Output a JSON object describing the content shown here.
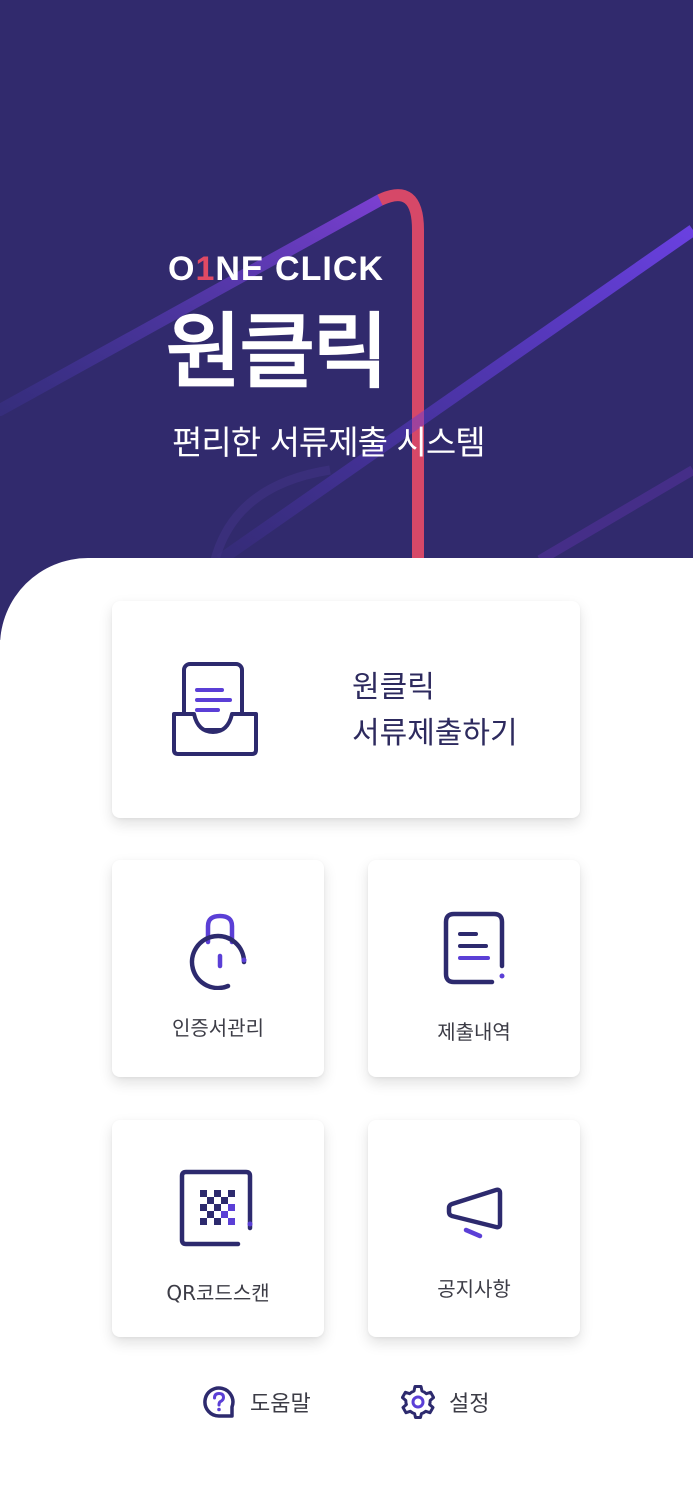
{
  "hero": {
    "brand_part1": "O",
    "brand_accent": "1",
    "brand_part2": "NE CLICK",
    "title": "원클릭",
    "subtitle": "편리한 서류제출 시스템"
  },
  "main_card": {
    "line1": "원클릭",
    "line2": "서류제출하기",
    "icon": "document-tray-icon"
  },
  "menu": [
    {
      "label": "인증서관리",
      "icon": "lock-icon"
    },
    {
      "label": "제출내역",
      "icon": "document-list-icon"
    },
    {
      "label": "QR코드스캔",
      "icon": "qr-code-icon"
    },
    {
      "label": "공지사항",
      "icon": "megaphone-icon"
    }
  ],
  "footer": {
    "help": "도움말",
    "settings": "설정"
  },
  "colors": {
    "hero_bg": "#312a6d",
    "accent": "#e04a64",
    "icon_primary": "#2d2a6e",
    "icon_accent": "#5b3fd6"
  }
}
